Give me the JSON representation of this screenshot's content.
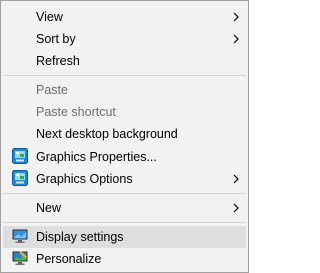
{
  "menu": {
    "items": [
      {
        "label": "View",
        "has_submenu": true
      },
      {
        "label": "Sort by",
        "has_submenu": true
      },
      {
        "label": "Refresh"
      },
      {
        "label": "Paste",
        "disabled": true
      },
      {
        "label": "Paste shortcut",
        "disabled": true
      },
      {
        "label": "Next desktop background"
      },
      {
        "label": "Graphics Properties...",
        "icon": "intel-graphics-icon"
      },
      {
        "label": "Graphics Options",
        "icon": "intel-graphics-icon",
        "has_submenu": true
      },
      {
        "label": "New",
        "has_submenu": true
      },
      {
        "label": "Display settings",
        "icon": "display-settings-icon",
        "highlighted": true
      },
      {
        "label": "Personalize",
        "icon": "personalize-icon"
      }
    ]
  },
  "colors": {
    "menu_background": "#f2f2f2",
    "menu_border": "#a0a0a0",
    "highlight": "#dedede",
    "disabled_text": "#6d6d6d",
    "separator": "#d7d7d7"
  }
}
